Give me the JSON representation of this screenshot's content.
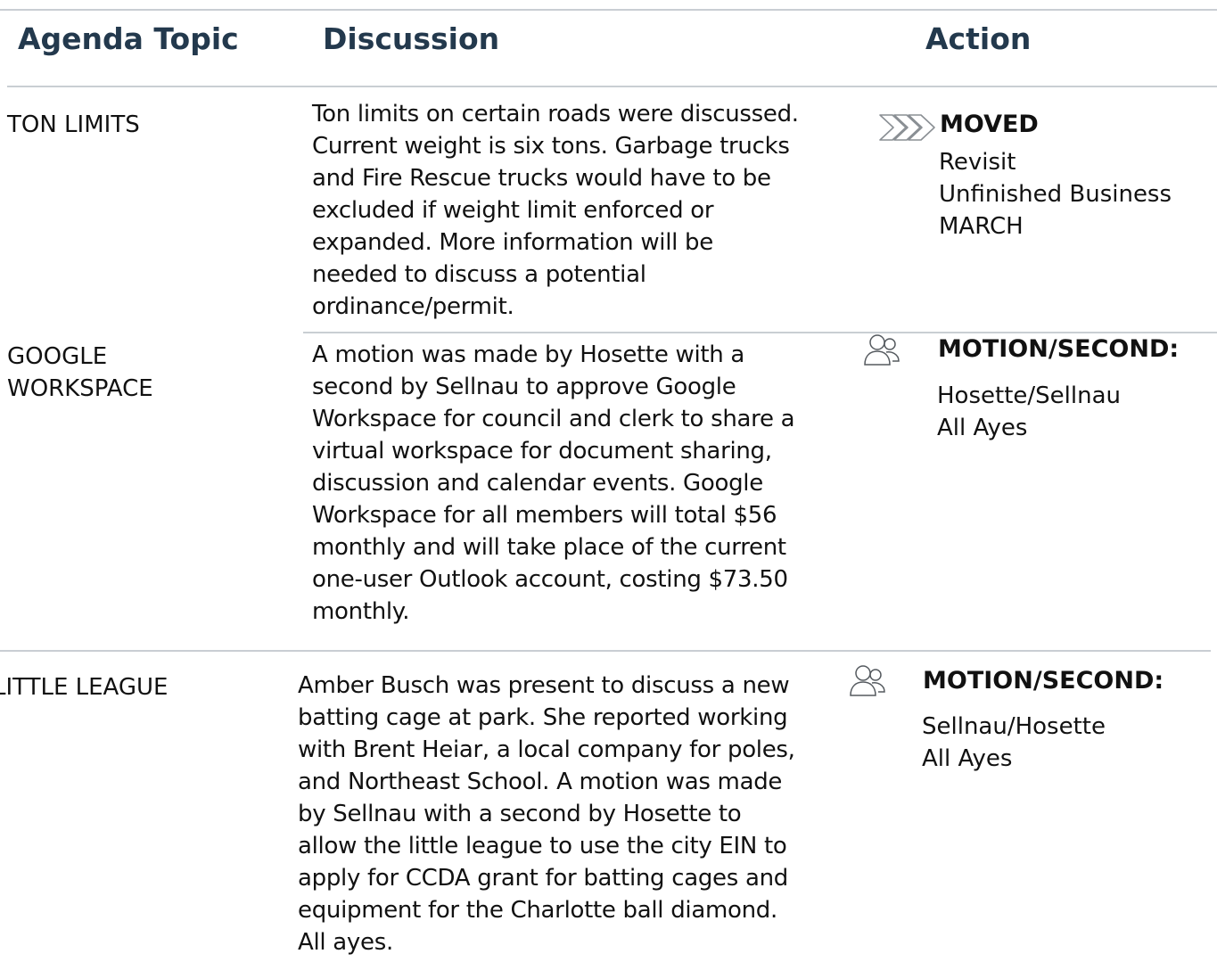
{
  "header": {
    "topic": "Agenda Topic",
    "discussion": "Discussion",
    "action": "Action"
  },
  "rows": [
    {
      "topic": [
        "TON LIMITS"
      ],
      "discussion": [
        "Ton limits on certain roads were discussed.",
        "Current weight is six tons.  Garbage trucks",
        "and Fire Rescue trucks would have to be",
        "excluded if weight limit enforced or",
        "expanded. More information will be",
        "needed to discuss a potential",
        "ordinance/permit."
      ],
      "action_icon": "forward-chevrons-icon",
      "action_title": "MOVED",
      "action_lines": [
        "Revisit",
        "Unfinished Business",
        "MARCH"
      ]
    },
    {
      "topic": [
        "GOOGLE",
        "WORKSPACE"
      ],
      "discussion": [
        "A motion was made by Hosette with a",
        "second by Sellnau to approve Google",
        "Workspace for council and clerk to share a",
        "virtual workspace for document sharing,",
        "discussion and calendar events.  Google",
        "Workspace for all members will total $56",
        "monthly and will take place of the current",
        "one-user Outlook account, costing $73.50",
        "monthly."
      ],
      "action_icon": "people-icon",
      "action_title": "MOTION/SECOND:",
      "action_lines": [
        "Hosette/Sellnau",
        "All Ayes"
      ]
    },
    {
      "topic": [
        "LITTLE LEAGUE"
      ],
      "discussion": [
        "Amber Busch was present to discuss a new",
        "batting cage at park. She reported working",
        "with Brent Heiar, a local company for poles,",
        "and Northeast School.  A motion was made",
        "by Sellnau with a second by Hosette to",
        "allow the little league to use the city EIN to",
        "apply for CCDA grant for batting cages and",
        "equipment for the Charlotte ball diamond.",
        "All ayes."
      ],
      "action_icon": "people-icon",
      "action_title": "MOTION/SECOND:",
      "action_lines": [
        "Sellnau/Hosette",
        "All Ayes"
      ]
    }
  ],
  "colors": {
    "header_text": "#23394d",
    "rule": "#c9ced3",
    "body_text": "#111111"
  }
}
